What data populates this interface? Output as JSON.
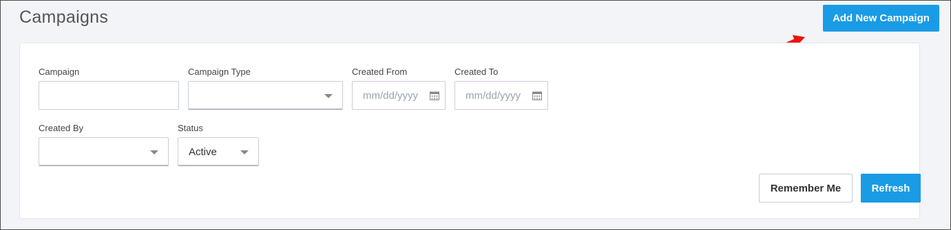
{
  "header": {
    "title": "Campaigns",
    "add_button_label": "Add New Campaign"
  },
  "filters": {
    "campaign": {
      "label": "Campaign",
      "value": ""
    },
    "campaign_type": {
      "label": "Campaign Type",
      "value": ""
    },
    "created_from": {
      "label": "Created From",
      "placeholder": "mm/dd/yyyy"
    },
    "created_to": {
      "label": "Created To",
      "placeholder": "mm/dd/yyyy"
    },
    "created_by": {
      "label": "Created By",
      "value": ""
    },
    "status": {
      "label": "Status",
      "value": "Active"
    }
  },
  "actions": {
    "remember_label": "Remember Me",
    "refresh_label": "Refresh"
  },
  "colors": {
    "accent": "#1a9be6",
    "annotation_arrow": "#ee1111"
  },
  "icons": {
    "calendar": "calendar-icon",
    "dropdown": "chevron-down-icon",
    "annotation": "red-arrow-annotation"
  }
}
